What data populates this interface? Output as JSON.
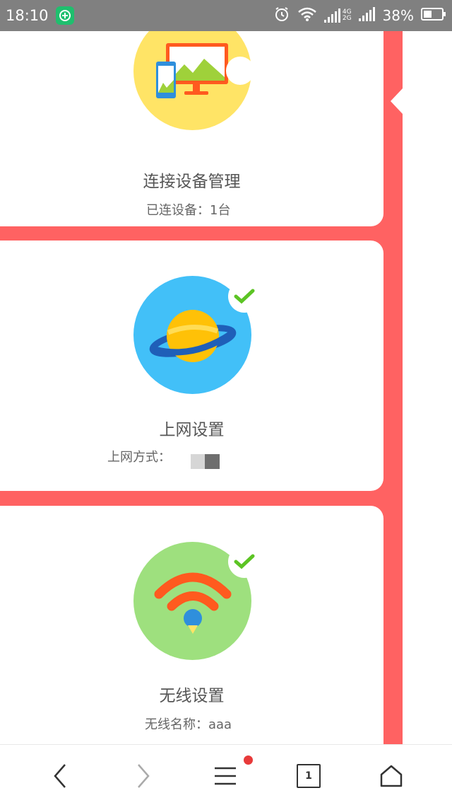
{
  "status_bar": {
    "time": "18:10",
    "network_4g": "4G",
    "network_2g": "2G",
    "battery": "38%"
  },
  "cards": [
    {
      "title": "连接设备管理",
      "desc_label": "已连设备：",
      "desc_value": "1台",
      "icon": "devices-icon",
      "circle_color": "#ffe466"
    },
    {
      "title": "上网设置",
      "desc_label": "上网方式：",
      "desc_value": "",
      "icon": "planet-icon",
      "circle_color": "#42c0f8",
      "checked": true
    },
    {
      "title": "无线设置",
      "desc_label": "无线名称：",
      "desc_value": "aaa",
      "icon": "wifi-icon",
      "circle_color": "#9ee07e",
      "checked": true
    }
  ],
  "bottom_nav": {
    "tab_count": "1",
    "items": [
      "back-icon",
      "forward-icon",
      "menu-icon",
      "tabs-icon",
      "home-icon"
    ]
  },
  "colors": {
    "page_red": "#ff6262",
    "check_green": "#5cc424",
    "status_gray": "#808080"
  }
}
